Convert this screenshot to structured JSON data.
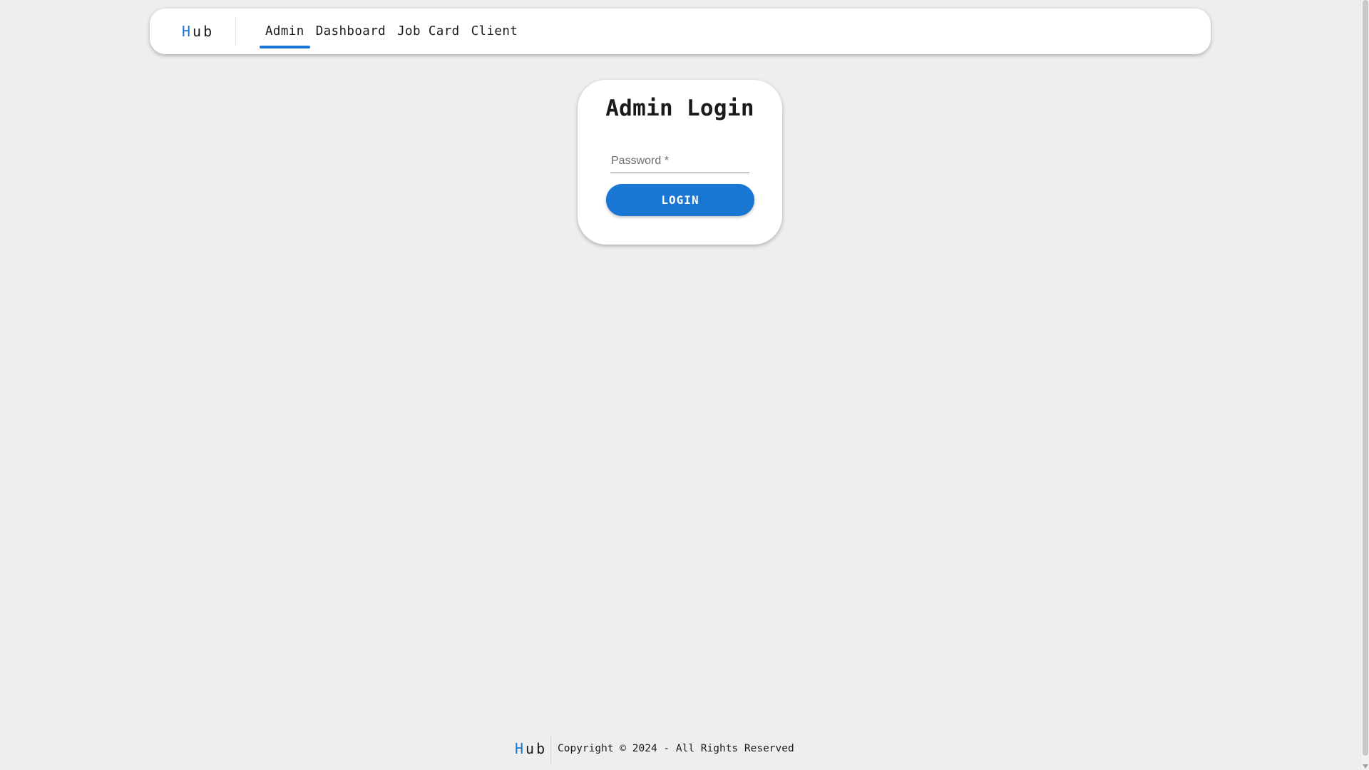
{
  "brand": {
    "logo_first_letter": "H",
    "logo_rest": "ub"
  },
  "navbar": {
    "links": [
      {
        "label": "Admin",
        "active": true
      },
      {
        "label": "Dashboard",
        "active": false
      },
      {
        "label": "Job Card",
        "active": false
      },
      {
        "label": "Client",
        "active": false
      }
    ],
    "theme_toggle_icon": "moon-icon"
  },
  "login": {
    "title": "Admin Login",
    "password_label": "Password *",
    "password_value": "",
    "button_label": "LOGIN"
  },
  "footer": {
    "logo_first_letter": "H",
    "logo_rest": "ub",
    "copyright": "Copyright © 2024 - All Rights Reserved"
  },
  "colors": {
    "accent": "#1976d2",
    "background": "#eeeeee",
    "card": "#ffffff",
    "text": "#1a1a1a"
  }
}
